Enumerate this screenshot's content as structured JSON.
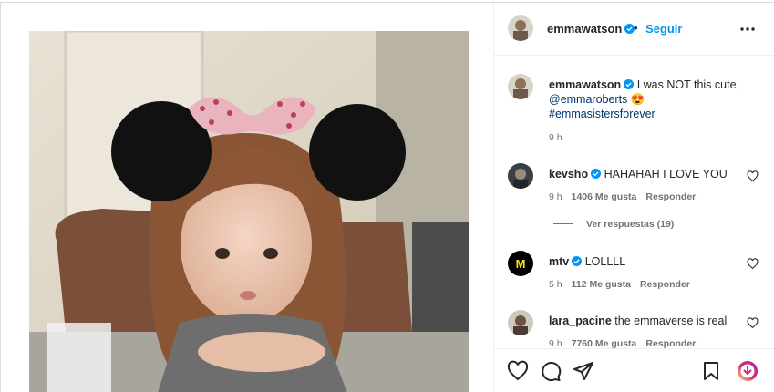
{
  "post": {
    "author": "emmawatson",
    "follow_label": "Seguir",
    "separator": "•",
    "caption": {
      "user": "emmawatson",
      "text": "I was NOT this cute,",
      "mention": "@emmaroberts",
      "emoji": "😍",
      "hashtag": "#emmasistersforever",
      "time": "9 h"
    }
  },
  "comments": [
    {
      "user": "kevsho",
      "verified": true,
      "text": "HAHAHAH I LOVE YOU",
      "time": "9 h",
      "likes": "1406 Me gusta",
      "reply": "Responder"
    },
    {
      "user": "mtv",
      "verified": true,
      "text": "LOLLLL",
      "time": "5 h",
      "likes": "112 Me gusta",
      "reply": "Responder"
    },
    {
      "user": "lara_pacine",
      "verified": false,
      "text": "the emmaverse is real",
      "time": "9 h",
      "likes": "7760 Me gusta",
      "reply": "Responder"
    }
  ],
  "view_replies": "Ver respuestas (19)",
  "icons": {
    "like": "heart-icon",
    "comment": "comment-icon",
    "share": "share-icon",
    "save": "bookmark-icon",
    "more": "more-icon",
    "verified": "verified-icon"
  },
  "colors": {
    "link": "#0095f6",
    "verified": "#0095f6",
    "text": "#262626",
    "muted": "#737373"
  }
}
